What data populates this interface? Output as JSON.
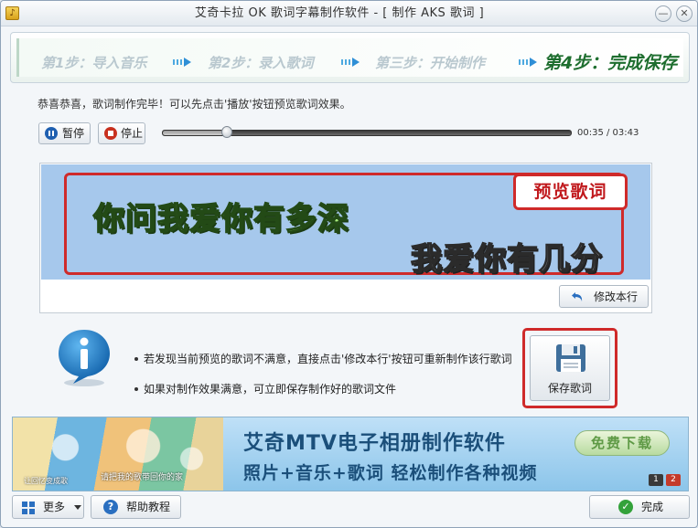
{
  "window": {
    "title": "艾奇卡拉 OK 歌词字幕制作软件 - [ 制作 AKS 歌词 ]",
    "min_glyph": "—",
    "close_glyph": "✕",
    "icon": "karaoke-app-icon"
  },
  "steps": [
    {
      "label": "第1步：导入音乐",
      "active": false
    },
    {
      "label": "第2步：录入歌词",
      "active": false
    },
    {
      "label": "第三步：开始制作",
      "active": false
    },
    {
      "label": "第4步：完成保存",
      "active": true
    }
  ],
  "message": "恭喜恭喜，歌词制作完毕！可以先点击'播放'按钮预览歌词效果。",
  "player": {
    "pause_label": "暂停",
    "stop_label": "停止",
    "time": "00:35 / 03:43",
    "progress": 0.16
  },
  "preview": {
    "badge": "预览歌词",
    "line1": "你问我爱你有多深",
    "line2": "我爱你有几分",
    "edit_label": "修改本行"
  },
  "tips": {
    "tip1": "若发现当前预览的歌词不满意，直接点击'修改本行'按钮可重新制作该行歌词",
    "tip2": "如果对制作效果满意，可立即保存制作好的歌词文件",
    "save_label": "保存歌词"
  },
  "banner": {
    "title": "艾奇MTV电子相册制作软件",
    "subtitle": "照片+音乐+歌词 轻松制作各种视频",
    "download_label": "免费下载",
    "caption1": "让回忆变成歌",
    "caption2": "请把我的歌带回你的家",
    "page1": "1",
    "page2": "2"
  },
  "footer": {
    "more_label": "更多",
    "help_label": "帮助教程",
    "finish_label": "完成",
    "help_glyph": "?",
    "finish_glyph": "✓"
  },
  "colors": {
    "highlight_red": "#cf2a2a",
    "lyric_sung": "#a6e97a",
    "lyric_unsung": "#ffffff",
    "lyric_bg": "#a6c8ec"
  }
}
